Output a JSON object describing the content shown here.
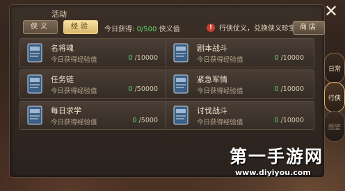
{
  "panel": {
    "title": "活动"
  },
  "tabs": [
    {
      "label": "侠义",
      "active": false
    },
    {
      "label": "经验",
      "active": true
    }
  ],
  "today": {
    "label": "今日获得:",
    "value": "0/500",
    "unit": "侠义值"
  },
  "notice": {
    "icon": "exclamation-icon",
    "text": "行侠仗义，兑换侠义珍宝"
  },
  "shop_label": "商店",
  "sub_label": "今日获得经验值",
  "cards": [
    {
      "name": "名将魂",
      "current": "0",
      "max": "/10000"
    },
    {
      "name": "剧本战斗",
      "current": "0",
      "max": "/10000"
    },
    {
      "name": "任务链",
      "current": "0",
      "max": "/50000"
    },
    {
      "name": "紧急军情",
      "current": "0",
      "max": "/10000"
    },
    {
      "name": "每日求学",
      "current": "0",
      "max": "/5000"
    },
    {
      "name": "讨伐战斗",
      "current": "0",
      "max": "/10000"
    }
  ],
  "side_tabs": [
    {
      "label": "日常"
    },
    {
      "label": "行侠"
    },
    {
      "label": "图鉴"
    }
  ],
  "close_symbol": "✕",
  "watermark": {
    "main": "第一手游网",
    "url": "www.diyiyou.com"
  },
  "colors": {
    "accent_green": "#62d66a",
    "active_tab": "#e9c982"
  }
}
